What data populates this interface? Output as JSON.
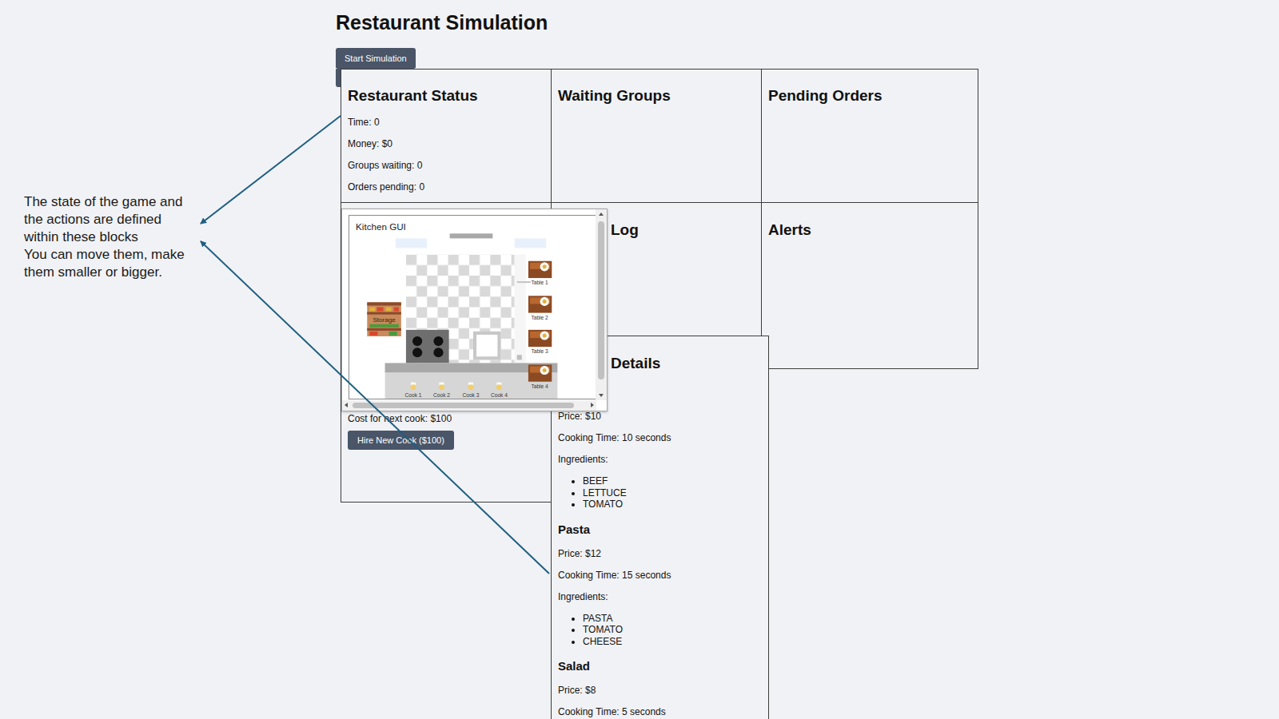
{
  "page": {
    "title": "Restaurant Simulation"
  },
  "toolbar": {
    "buttons": [
      {
        "label": "Start Simulation"
      }
    ]
  },
  "annotation": {
    "lines": [
      "The state of the game and",
      "the actions are defined",
      "within these blocks",
      "You can move them, make",
      "them smaller or bigger."
    ]
  },
  "panels": {
    "status": {
      "title": "Restaurant Status",
      "lines": [
        "Time: 0",
        "Money: $0",
        "Groups waiting: 0",
        "Orders pending: 0"
      ]
    },
    "waiting": {
      "title": "Waiting Groups"
    },
    "pending": {
      "title": "Pending Orders"
    },
    "log": {
      "title": "Log"
    },
    "alerts": {
      "title": "Alerts"
    },
    "cooks": {
      "cost": "Cost for next cook: $100",
      "hire_button": "Hire New Cook ($100)"
    },
    "menu": {
      "title": "Details",
      "items": [
        {
          "price": "Price: $10",
          "time": "Cooking Time: 10 seconds",
          "ingredients_label": "Ingredients:",
          "ingredients": [
            "BEEF",
            "LETTUCE",
            "TOMATO"
          ]
        },
        {
          "name": "Pasta",
          "price": "Price: $12",
          "time": "Cooking Time: 15 seconds",
          "ingredients_label": "Ingredients:",
          "ingredients": [
            "PASTA",
            "TOMATO",
            "CHEESE"
          ]
        },
        {
          "name": "Salad",
          "price": "Price: $8",
          "time": "Cooking Time: 5 seconds"
        }
      ]
    }
  },
  "kitchen": {
    "title": "Kitchen GUI",
    "storage": "Storage",
    "tables": [
      "Table 1",
      "Table 2",
      "Table 3",
      "Table 4"
    ],
    "cooks": [
      "Cook 1",
      "Cook 2",
      "Cook 3",
      "Cook 4"
    ]
  }
}
